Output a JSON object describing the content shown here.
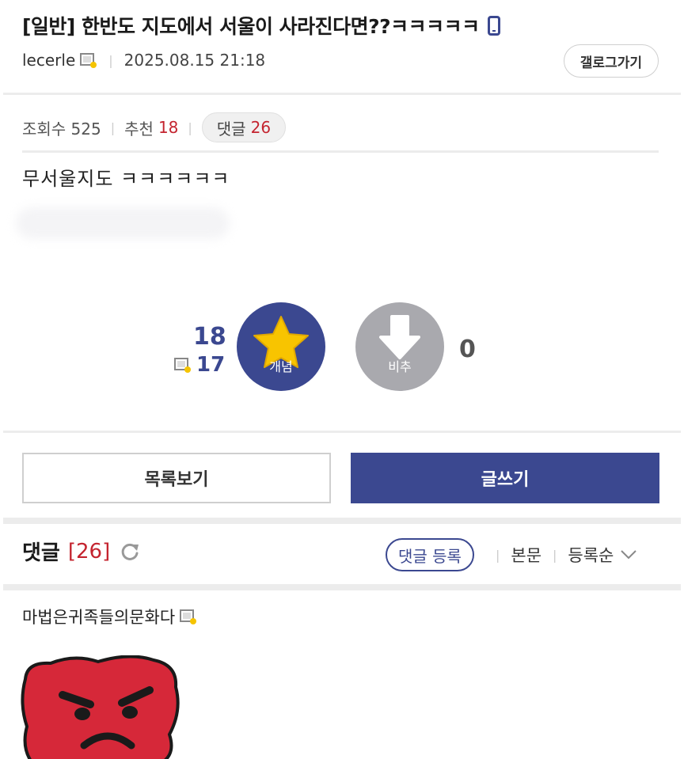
{
  "post": {
    "title": "[일반] 한반도 지도에서 서울이 사라진다면??ㅋㅋㅋㅋㅋ",
    "author": "lecerle",
    "date": "2025.08.15 21:18",
    "gallery_button": "갤로그가기",
    "views_label": "조회수 525",
    "recommend_label": "추천",
    "recommend_count": "18",
    "comment_label": "댓글",
    "comment_count": "26",
    "body": "무서울지도 ㅋㅋㅋㅋㅋㅋ"
  },
  "votes": {
    "up_count": "18",
    "fixed_count": "17",
    "up_label": "개념",
    "down_label": "비추",
    "down_count": "0"
  },
  "actions": {
    "list_label": "목록보기",
    "write_label": "글쓰기"
  },
  "comments": {
    "title": "댓글",
    "count_display": "[26]",
    "register_label": "댓글 등록",
    "body_label": "본문",
    "sort_label": "등록순",
    "first_author": "마법은귀족들의문화다"
  },
  "colors": {
    "accent": "#3b4890",
    "red": "#c4242f",
    "down": "#a9a9ae"
  }
}
